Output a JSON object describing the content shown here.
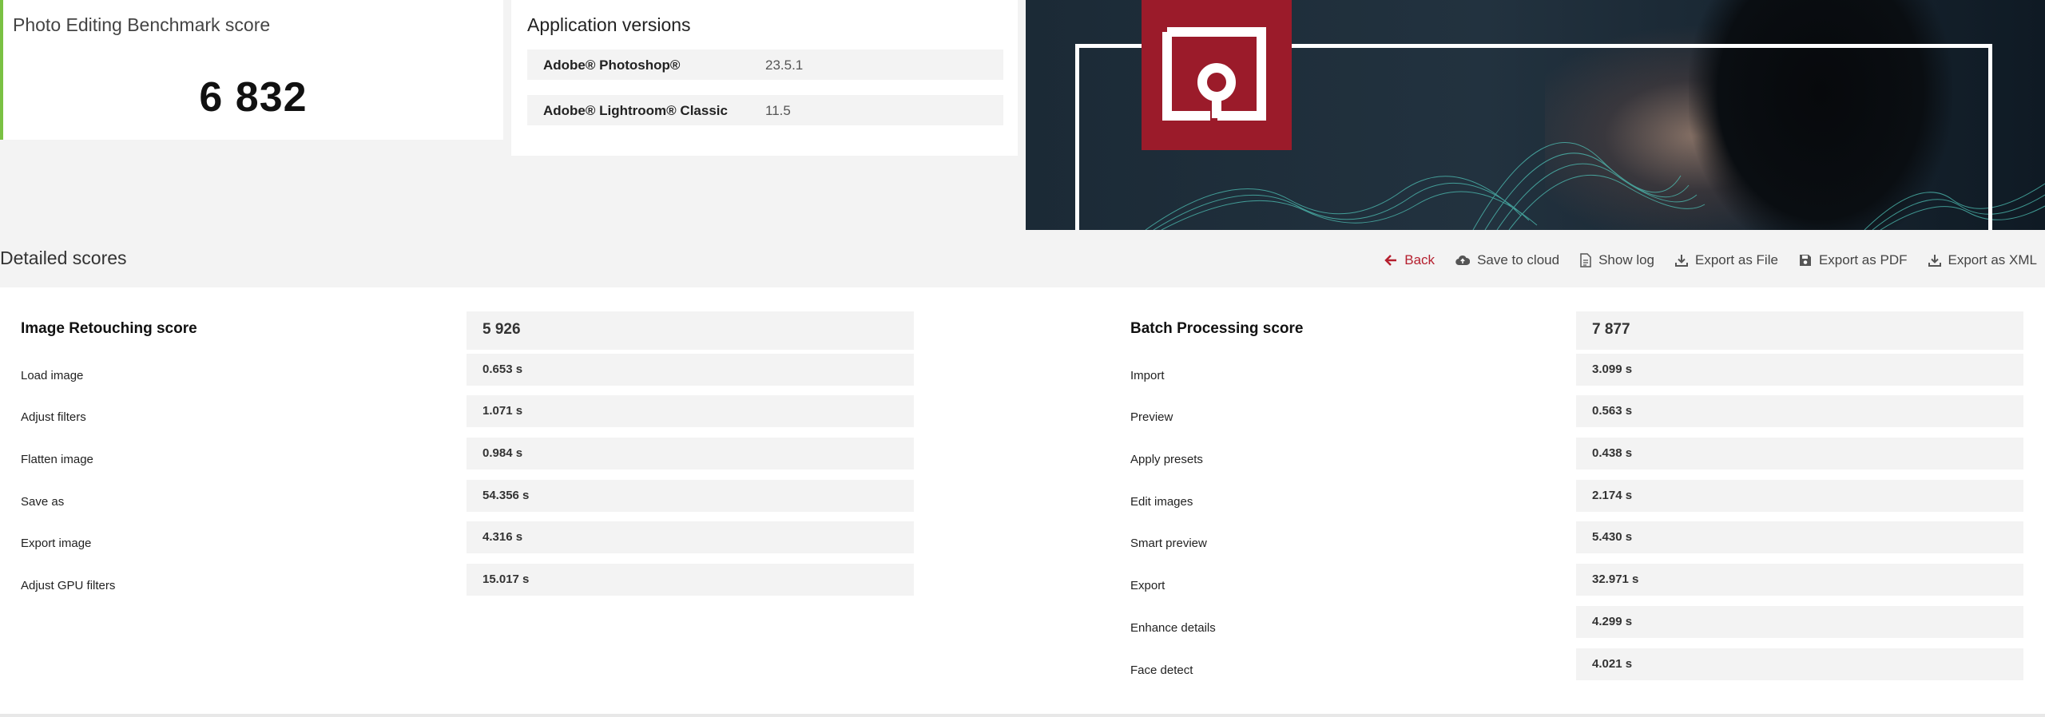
{
  "summary": {
    "title": "Photo Editing Benchmark score",
    "score": "6 832",
    "accent_color": "#7ac143"
  },
  "versions": {
    "title": "Application versions",
    "items": [
      {
        "name": "Adobe® Photoshop®",
        "version": "23.5.1"
      },
      {
        "name": "Adobe® Lightroom® Classic",
        "version": "11.5"
      }
    ]
  },
  "detail": {
    "title": "Detailed scores"
  },
  "toolbar": {
    "back": "Back",
    "save_cloud": "Save to cloud",
    "show_log": "Show log",
    "export_file": "Export as File",
    "export_pdf": "Export as PDF",
    "export_xml": "Export as XML",
    "back_color": "#b51f2e"
  },
  "retouching": {
    "title": "Image Retouching score",
    "score": "5 926",
    "items": [
      {
        "label": "Load image",
        "value": "0.653 s"
      },
      {
        "label": "Adjust filters",
        "value": "1.071 s"
      },
      {
        "label": "Flatten image",
        "value": "0.984 s"
      },
      {
        "label": "Save as",
        "value": "54.356 s"
      },
      {
        "label": "Export image",
        "value": "4.316 s"
      },
      {
        "label": "Adjust GPU filters",
        "value": "15.017 s"
      }
    ]
  },
  "batch": {
    "title": "Batch Processing score",
    "score": "7 877",
    "items": [
      {
        "label": "Import",
        "value": "3.099 s"
      },
      {
        "label": "Preview",
        "value": "0.563 s"
      },
      {
        "label": "Apply presets",
        "value": "0.438 s"
      },
      {
        "label": "Edit images",
        "value": "2.174 s"
      },
      {
        "label": "Smart preview",
        "value": "5.430 s"
      },
      {
        "label": "Export",
        "value": "32.971 s"
      },
      {
        "label": "Enhance details",
        "value": "4.299 s"
      },
      {
        "label": "Face detect",
        "value": "4.021 s"
      }
    ]
  }
}
